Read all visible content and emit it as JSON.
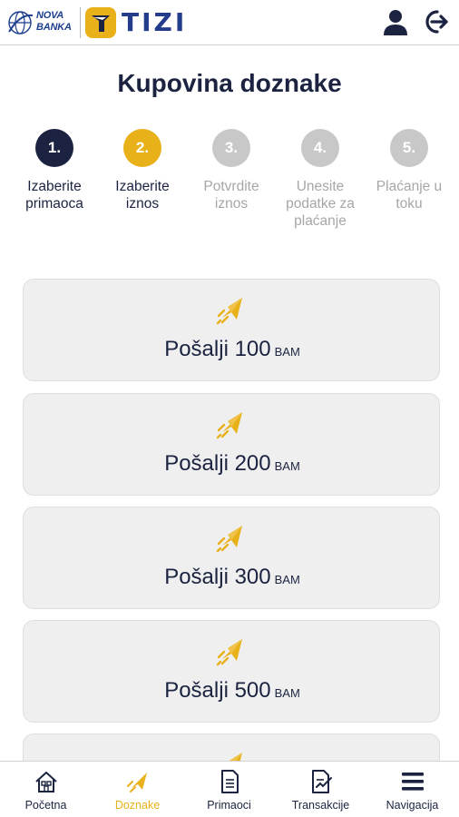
{
  "header": {
    "nova_logo_text_line1": "NOVA",
    "nova_logo_text_line2": "BANKA",
    "app_name": "TIZI",
    "profile_icon": "user-icon",
    "logout_icon": "logout-icon"
  },
  "page_title": "Kupovina doznake",
  "steps": [
    {
      "number": "1.",
      "label": "Izaberite primaoca",
      "state": "done"
    },
    {
      "number": "2.",
      "label": "Izaberite iznos",
      "state": "active"
    },
    {
      "number": "3.",
      "label": "Potvrdite iznos",
      "state": "todo"
    },
    {
      "number": "4.",
      "label": "Unesite podatke za plaćanje",
      "state": "todo"
    },
    {
      "number": "5.",
      "label": "Plaćanje u toku",
      "state": "todo"
    }
  ],
  "amount_options": [
    {
      "prefix": "Pošalji",
      "amount": "100",
      "currency": "BAM"
    },
    {
      "prefix": "Pošalji",
      "amount": "200",
      "currency": "BAM"
    },
    {
      "prefix": "Pošalji",
      "amount": "300",
      "currency": "BAM"
    },
    {
      "prefix": "Pošalji",
      "amount": "500",
      "currency": "BAM"
    }
  ],
  "bottom_nav": [
    {
      "label": "Početna",
      "icon": "home-icon",
      "active": false
    },
    {
      "label": "Doznake",
      "icon": "paper-plane-icon",
      "active": true
    },
    {
      "label": "Primaoci",
      "icon": "document-icon",
      "active": false
    },
    {
      "label": "Transakcije",
      "icon": "transactions-icon",
      "active": false
    },
    {
      "label": "Navigacija",
      "icon": "menu-icon",
      "active": false
    }
  ],
  "colors": {
    "navy": "#1b2340",
    "accent": "#e8b11a",
    "inactive": "#c8c8c8",
    "card_bg": "#efefef"
  }
}
